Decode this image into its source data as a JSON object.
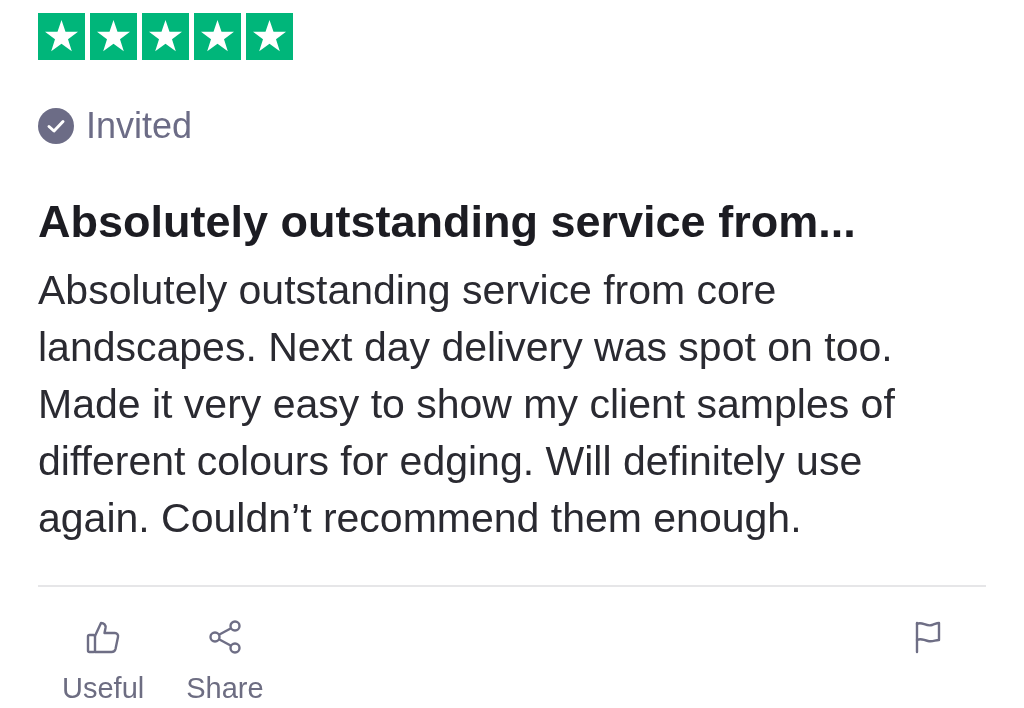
{
  "rating": {
    "stars": 5
  },
  "badge": {
    "label": "Invited"
  },
  "review": {
    "title": "Absolutely outstanding service from...",
    "body": "Absolutely outstanding service from core landscapes. Next day delivery was spot on too. Made it very easy to show my client samples of different colours for edging. Will definitely use again. Couldn’t recommend them enough."
  },
  "actions": [
    {
      "kind": "useful",
      "label": "Useful"
    },
    {
      "kind": "share",
      "label": "Share"
    },
    {
      "kind": "report"
    }
  ]
}
